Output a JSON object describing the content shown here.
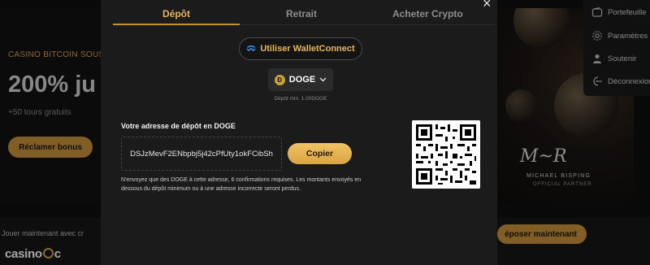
{
  "background": {
    "hero": {
      "kicker": "CASINO BITCOIN SOUS",
      "headline": "200% ju",
      "subtext": "+50 tours gratuits",
      "claim_button": "Réclamer bonus"
    },
    "join_text": "Jouer maintenant avec cr",
    "logo": {
      "left": "casino",
      "right": "c"
    },
    "deposit_now_button": "époser maintenant",
    "promo": {
      "signature": "M~R",
      "name": "MICHAEL BISPING",
      "title": "OFFICIAL PARTNER"
    },
    "menu": [
      {
        "label": "Portefeuille",
        "icon": "wallet-icon"
      },
      {
        "label": "Paramètres",
        "icon": "gear-icon"
      },
      {
        "label": "Soutenir",
        "icon": "user-icon"
      },
      {
        "label": "Déconnexion",
        "icon": "logout-icon"
      }
    ]
  },
  "modal": {
    "tabs": [
      {
        "label": "Dépôt",
        "active": true
      },
      {
        "label": "Retrait",
        "active": false
      },
      {
        "label": "Acheter Crypto",
        "active": false
      }
    ],
    "close_glyph": "×",
    "walletconnect_label": "Utiliser WalletConnect",
    "currency": {
      "badge": "Ð",
      "selected": "DOGE"
    },
    "min_deposit": "Dépôt min. 1.00DOGE",
    "address_label": "Votre adresse de dépôt en DOGE",
    "address": "DSJzMevF2ENbpbj5j42cPfUty1okFCibSh",
    "copy_label": "Copier",
    "notice": "N'envoyez que des DOGE à cette adresse, 6 confirmations requises. Les montants envoyés en dessous du dépôt minimum ou à une adresse incorrecte seront perdus."
  },
  "colors": {
    "accent": "#e8b358",
    "button": "#c7913a",
    "modal_bg": "#1b1b1b"
  }
}
